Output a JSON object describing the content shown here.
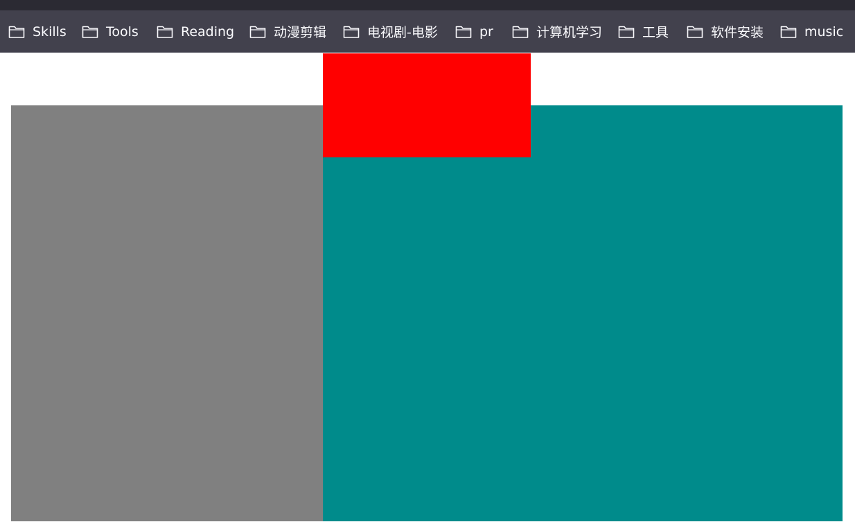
{
  "bookmarks": [
    {
      "label": "Skills",
      "icon": "folder-icon"
    },
    {
      "label": "Tools",
      "icon": "folder-icon"
    },
    {
      "label": "Reading",
      "icon": "folder-icon"
    },
    {
      "label": "动漫剪辑",
      "icon": "folder-icon"
    },
    {
      "label": "电视剧-电影",
      "icon": "folder-icon"
    },
    {
      "label": "pr",
      "icon": "folder-icon"
    },
    {
      "label": "计算机学习",
      "icon": "folder-icon"
    },
    {
      "label": "工具",
      "icon": "folder-icon"
    },
    {
      "label": "软件安装",
      "icon": "folder-icon"
    },
    {
      "label": "music",
      "icon": "folder-icon"
    }
  ],
  "colors": {
    "titlebar": "#2b2a33",
    "bookmarks_bar": "#42414d",
    "bookmark_text": "#fbfbfe",
    "page_background": "#ffffff",
    "gray_box": "#808080",
    "teal_box": "#008b8b",
    "red_box": "#ff0000"
  }
}
